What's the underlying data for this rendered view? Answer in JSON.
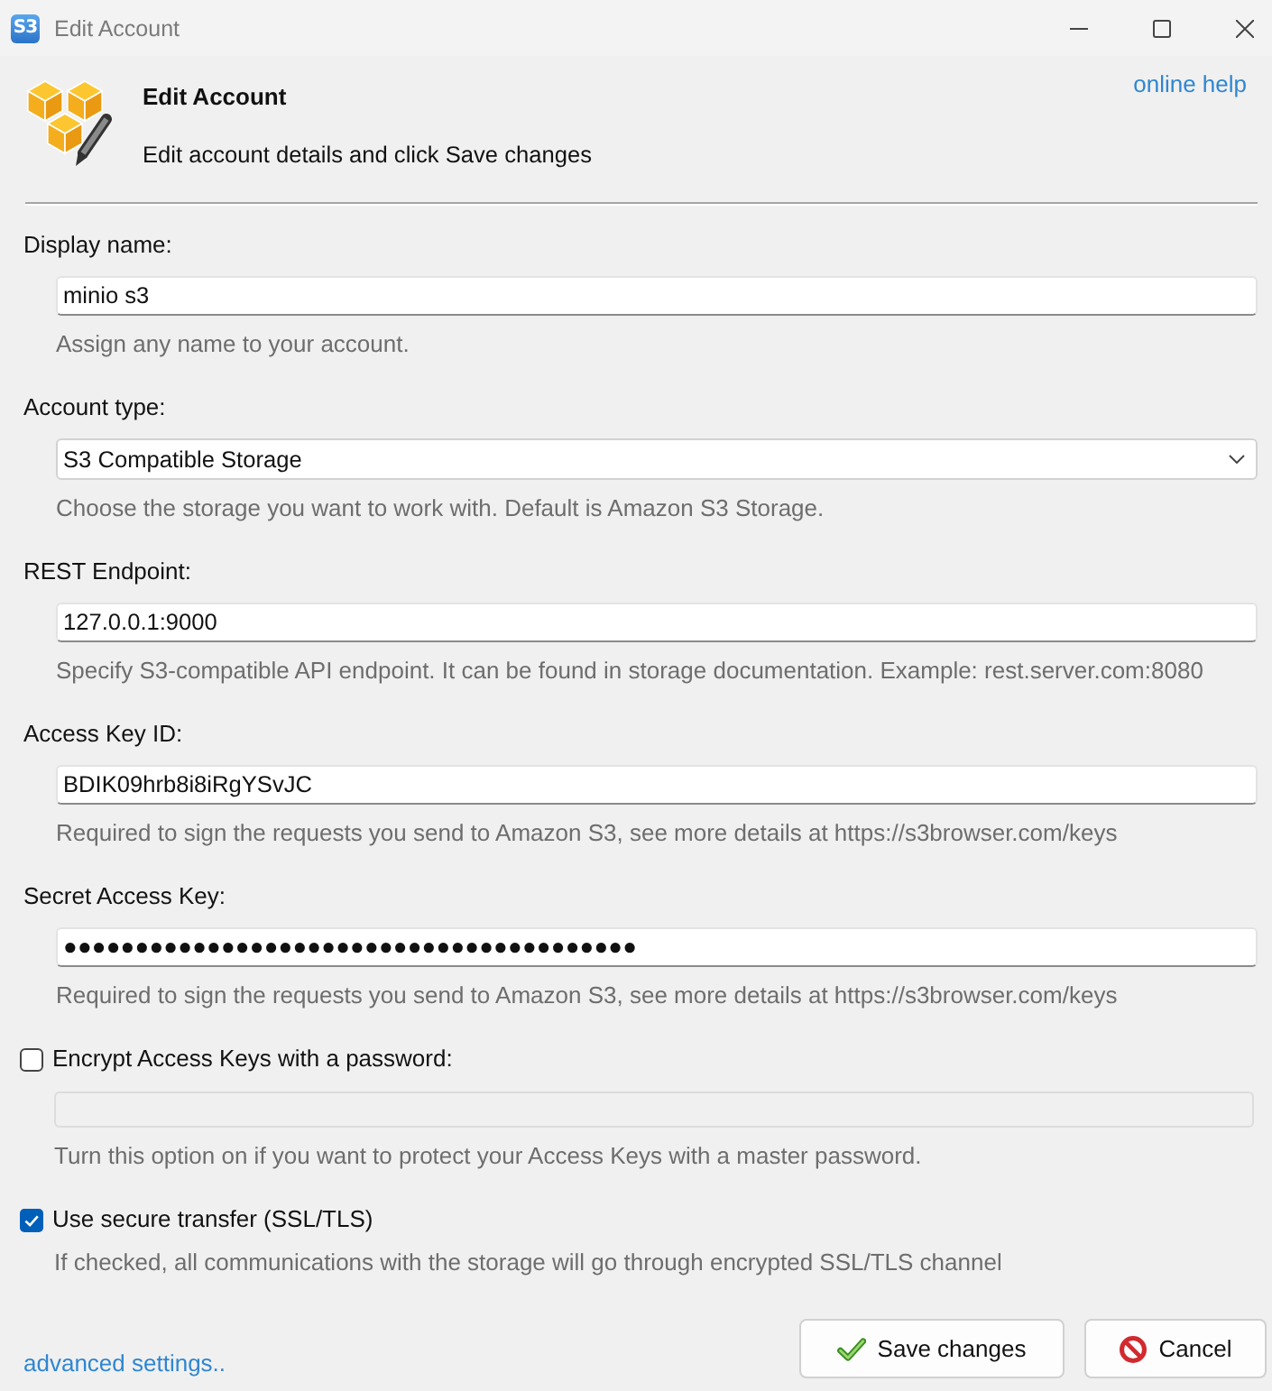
{
  "window": {
    "icon_text": "S3",
    "title": "Edit Account"
  },
  "header": {
    "title": "Edit Account",
    "subtitle": "Edit account details and click Save changes",
    "help_link": "online help"
  },
  "fields": [
    {
      "kind": "text",
      "label": "Display name:",
      "value": "minio s3",
      "hint": "Assign any name to your account."
    },
    {
      "kind": "select",
      "label": "Account type:",
      "value": "S3 Compatible Storage",
      "hint": "Choose the storage you want to work with. Default is Amazon S3 Storage."
    },
    {
      "kind": "text",
      "label": "REST Endpoint:",
      "value": "127.0.0.1:9000",
      "hint": "Specify S3-compatible API endpoint. It can be found in storage documentation. Example: rest.server.com:8080"
    },
    {
      "kind": "text",
      "label": "Access Key ID:",
      "value": "BDIK09hrb8i8iRgYSvJC",
      "hint": "Required to sign the requests you send to Amazon S3, see more details at https://s3browser.com/keys"
    },
    {
      "kind": "password",
      "label": "Secret Access Key:",
      "value": "●●●●●●●●●●●●●●●●●●●●●●●●●●●●●●●●●●●●●●●●",
      "hint": "Required to sign the requests you send to Amazon S3, see more details at https://s3browser.com/keys"
    },
    {
      "kind": "checkbox",
      "label": "Encrypt Access Keys with a password:",
      "checked": false,
      "field": {
        "disabled": true
      },
      "hint": "Turn this option on if you want to protect your Access Keys with a master password."
    },
    {
      "kind": "checkbox",
      "label": "Use secure transfer (SSL/TLS)",
      "checked": true,
      "hint": "If checked, all communications with the storage will go through encrypted SSL/TLS channel"
    }
  ],
  "footer": {
    "link": "advanced settings..",
    "buttons": [
      {
        "kind": "save",
        "label": "Save changes"
      },
      {
        "kind": "cancel",
        "label": "Cancel"
      }
    ]
  }
}
